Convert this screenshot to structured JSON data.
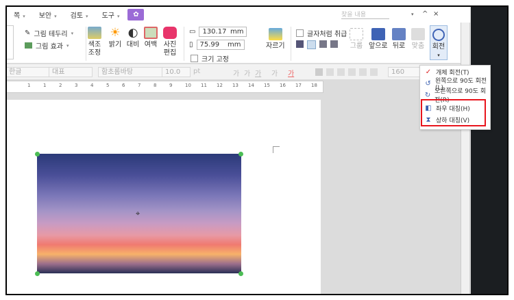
{
  "menubar": {
    "items": [
      "쪽",
      "보안",
      "검토",
      "도구"
    ],
    "plugin_icon": "flower-icon",
    "search_placeholder": "찾을 내용",
    "collapse": "^",
    "close": "×"
  },
  "ribbon": {
    "border_label": "그림 테두리",
    "effect_label": "그림 효과",
    "color_adjust": [
      "색조",
      "조정"
    ],
    "brightness": "밝기",
    "contrast": "대비",
    "margin": "여백",
    "photo_edit": [
      "사진",
      "편집"
    ],
    "width_value": "130.17",
    "height_value": "75.99",
    "unit": "mm",
    "size_lock": "크기 고정",
    "crop": "자르기",
    "treat_as_char": "글자처럼 취급",
    "group": "그룹",
    "bring_front": "앞으로",
    "send_back": "뒤로",
    "align": "맞춤",
    "rotate": "회전",
    "more": "»"
  },
  "format_bar": {
    "lang": "한글",
    "style": "대표",
    "font": "함초롬바탕",
    "size": "10.0",
    "size_unit": "pt",
    "bold": "가",
    "italic": "가",
    "underline": "가",
    "strike": "가",
    "color": "가",
    "line_spacing": "160"
  },
  "ruler": {
    "ticks": [
      "1",
      "1",
      "2",
      "3",
      "4",
      "5",
      "6",
      "7",
      "8",
      "9",
      "10",
      "11",
      "12",
      "13",
      "14",
      "15",
      "16",
      "17",
      "18"
    ]
  },
  "dropdown": {
    "items": [
      {
        "label": "개체 회전(T)",
        "icon": "rotate-free-icon"
      },
      {
        "label": "왼쪽으로 90도 회전(L)",
        "icon": "rotate-left-icon"
      },
      {
        "label": "오른쪽으로 90도 회전(R)",
        "icon": "rotate-right-icon"
      },
      {
        "label": "좌우 대칭(H)",
        "icon": "flip-horizontal-icon"
      },
      {
        "label": "상하 대칭(V)",
        "icon": "flip-vertical-icon"
      }
    ]
  },
  "colors": {
    "highlight": "#e8141c",
    "accent": "#9b6bd6",
    "handle": "#4cbd55"
  }
}
